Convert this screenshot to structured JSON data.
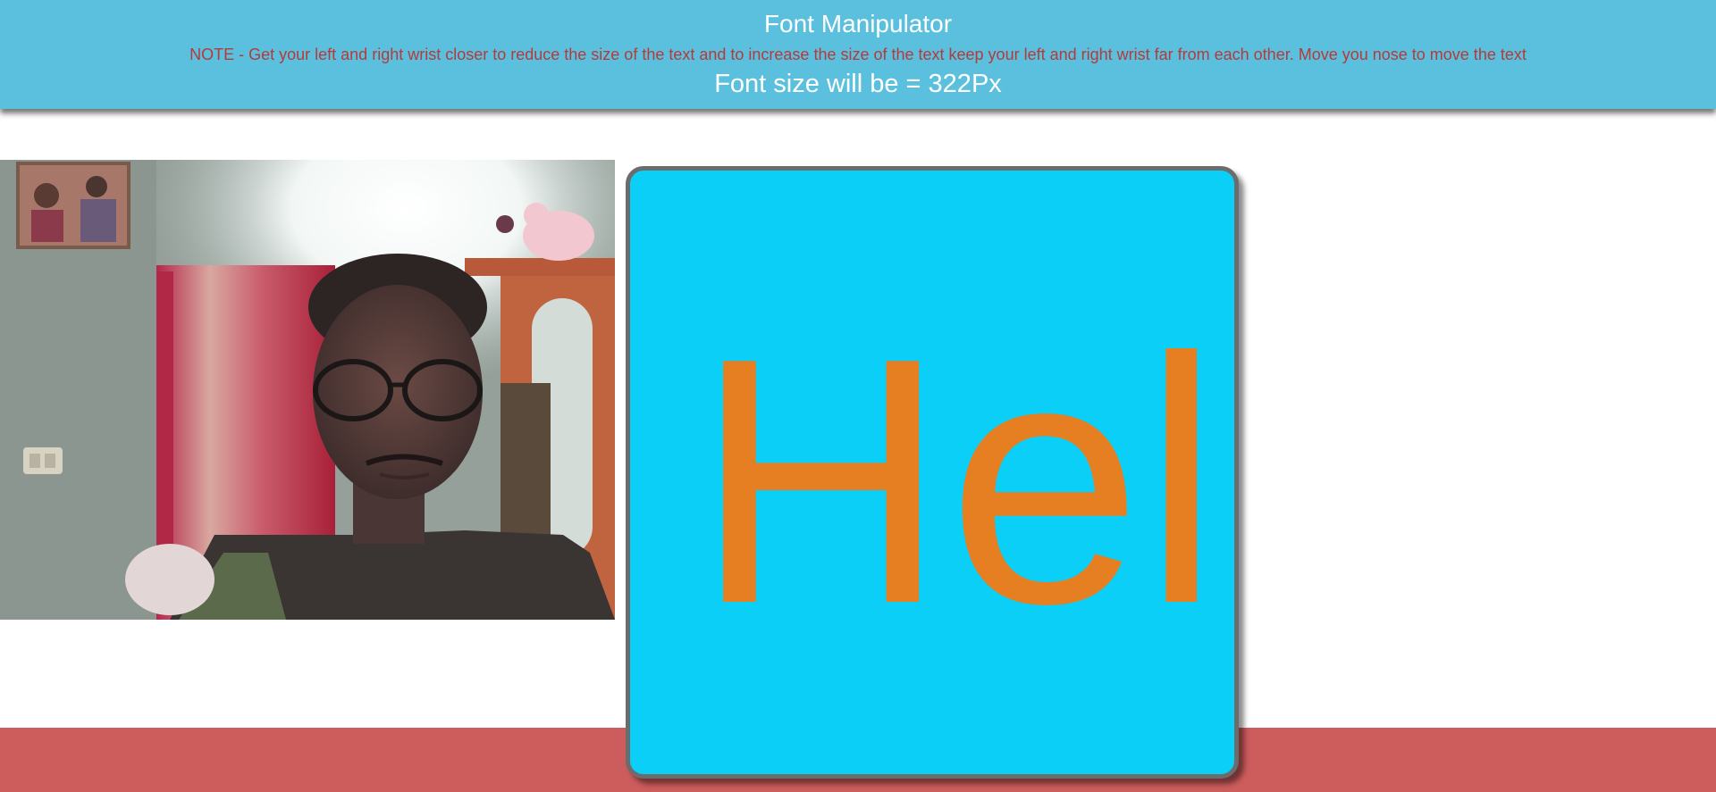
{
  "header": {
    "title": "Font Manipulator",
    "note": "NOTE - Get your left and right wrist closer to reduce the size of the text and to increase the size of the text keep your left and right wrist far from each other. Move you nose to move the text",
    "font_size_text": "Font size will be = 322Px"
  },
  "canvas": {
    "text": "Hel"
  },
  "colors": {
    "header_bg": "#5bc0de",
    "note": "#b53a3a",
    "box_bg": "#0bcff7",
    "box_text": "#e67e22",
    "footer_band": "#cd5c5c"
  }
}
